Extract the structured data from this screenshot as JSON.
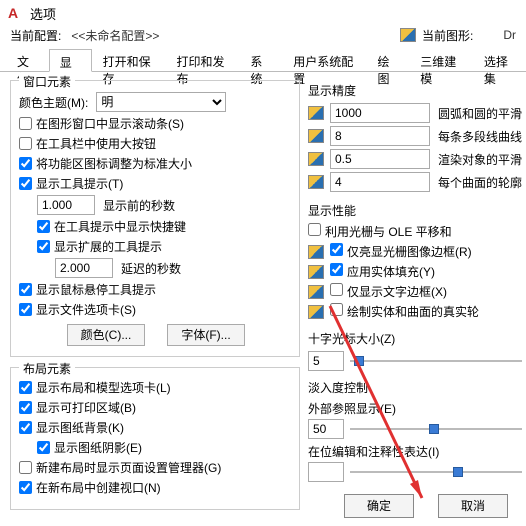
{
  "titlebar": {
    "logo": "A",
    "title": "选项"
  },
  "profile": {
    "current_label": "当前配置:",
    "current_value": "<<未命名配置>>",
    "drawing_label": "当前图形:",
    "drawing_value": "Dr"
  },
  "tabs": [
    "文件",
    "显示",
    "打开和保存",
    "打印和发布",
    "系统",
    "用户系统配置",
    "绘图",
    "三维建模",
    "选择集"
  ],
  "active_tab": "显示",
  "window_elements": {
    "title": "窗口元素",
    "theme_label": "颜色主题(M):",
    "theme_value": "明",
    "items": {
      "scrollbar": "在图形窗口中显示滚动条(S)",
      "bigbtn": "在工具栏中使用大按钮",
      "ribbon": "将功能区图标调整为标准大小",
      "tooltip": "显示工具提示(T)",
      "delay_label": "显示前的秒数",
      "delay_value": "1.000",
      "shortcut": "在工具提示中显示快捷键",
      "ext_tip": "显示扩展的工具提示",
      "ext_delay_label": "延迟的秒数",
      "ext_delay_value": "2.000",
      "hover": "显示鼠标悬停工具提示",
      "filetab": "显示文件选项卡(S)",
      "color_btn": "颜色(C)...",
      "font_btn": "字体(F)..."
    }
  },
  "layout_elements": {
    "title": "布局元素",
    "items": {
      "layout_tabs": "显示布局和模型选项卡(L)",
      "printable": "显示可打印区域(B)",
      "paper_bg": "显示图纸背景(K)",
      "paper_shadow": "显示图纸阴影(E)",
      "new_pagesetup": "新建布局时显示页面设置管理器(G)",
      "viewport": "在新布局中创建视口(N)"
    }
  },
  "precision": {
    "title": "显示精度",
    "r1_val": "1000",
    "r1_lbl": "圆弧和圆的平滑",
    "r2_val": "8",
    "r2_lbl": "每条多段线曲线",
    "r3_val": "0.5",
    "r3_lbl": "渲染对象的平滑",
    "r4_val": "4",
    "r4_lbl": "每个曲面的轮廓"
  },
  "performance": {
    "title": "显示性能",
    "ole": "利用光栅与 OLE 平移和",
    "raster_frame": "仅亮显光栅图像边框(R)",
    "solid_fill": "应用实体填充(Y)",
    "text_frame": "仅显示文字边框(X)",
    "true_sil": "绘制实体和曲面的真实轮"
  },
  "crosshair": {
    "title": "十字光标大小(Z)",
    "value": "5"
  },
  "fade": {
    "title": "淡入度控制",
    "xref_label": "外部参照显示(E)",
    "xref_value": "50",
    "inplace_label": "在位编辑和注释性表达(I)"
  },
  "footer": {
    "ok": "确定",
    "cancel": "取消"
  }
}
